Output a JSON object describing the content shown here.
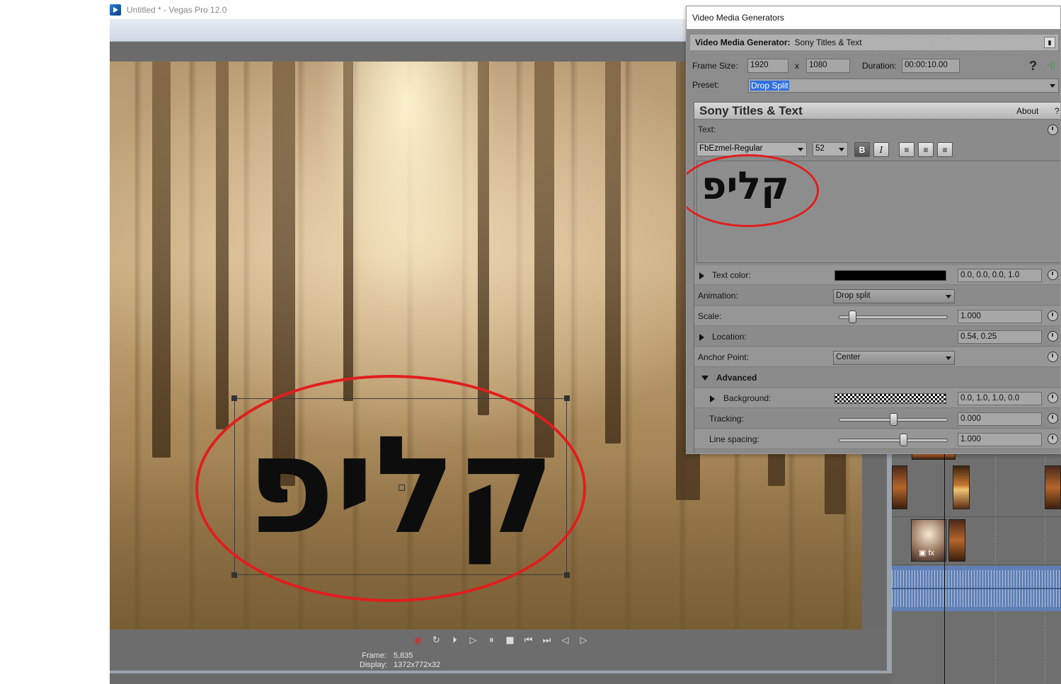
{
  "app": {
    "title": "Untitled * - Vegas Pro 12.0"
  },
  "preview": {
    "overlay_text": "קליפ",
    "status": {
      "frame_label": "Frame:",
      "frame_value": "5,835",
      "display_label": "Display:",
      "display_value": "1372x772x32"
    }
  },
  "transport": {
    "buttons": [
      {
        "name": "record-button",
        "glyph": "◉"
      },
      {
        "name": "loop-playback-button",
        "glyph": "↻"
      },
      {
        "name": "play-from-start-button",
        "glyph": "⏵"
      },
      {
        "name": "play-button",
        "glyph": "▷"
      },
      {
        "name": "pause-button",
        "glyph": "⏸"
      },
      {
        "name": "stop-button",
        "glyph": "■"
      },
      {
        "name": "go-to-start-button",
        "glyph": "⏮"
      },
      {
        "name": "go-to-end-button",
        "glyph": "⏭"
      },
      {
        "name": "previous-frame-button",
        "glyph": "◁"
      },
      {
        "name": "next-frame-button",
        "glyph": "▷"
      }
    ]
  },
  "generator": {
    "window_title": "Video Media Generators",
    "header_label": "Video Media Generator:",
    "header_value": "Sony Titles & Text",
    "frame_size_label": "Frame Size:",
    "frame_width": "1920",
    "frame_x": "x",
    "frame_height": "1080",
    "duration_label": "Duration:",
    "duration_value": "00:00:10.00",
    "preset_label": "Preset:",
    "preset_value": "Drop Split",
    "help": "?",
    "plugin": {
      "name": "Sony Titles & Text",
      "about": "About",
      "help": "?",
      "text_label": "Text:",
      "font": "FbEzmel-Regular",
      "size": "52",
      "bold": "B",
      "italic": "I",
      "editor_text": "קליפ"
    },
    "properties": {
      "text_color": {
        "label": "Text color:",
        "value": "0.0, 0.0, 0.0, 1.0"
      },
      "animation": {
        "label": "Animation:",
        "value": "Drop split"
      },
      "scale": {
        "label": "Scale:",
        "value": "1.000",
        "level": 0.09
      },
      "location": {
        "label": "Location:",
        "value": "0.54, 0.25"
      },
      "anchor": {
        "label": "Anchor Point:",
        "value": "Center"
      },
      "advanced": {
        "label": "Advanced"
      },
      "background": {
        "label": "Background:",
        "value": "0.0, 1.0, 1.0, 0.0"
      },
      "tracking": {
        "label": "Tracking:",
        "value": "0.000",
        "level": 0.5
      },
      "line_spacing": {
        "label": "Line spacing:",
        "value": "1.000",
        "level": 0.6
      }
    }
  },
  "colors": {
    "highlight": "#e21d1d",
    "selection": "#2f6fe0",
    "audio": "#5f7fb5"
  }
}
